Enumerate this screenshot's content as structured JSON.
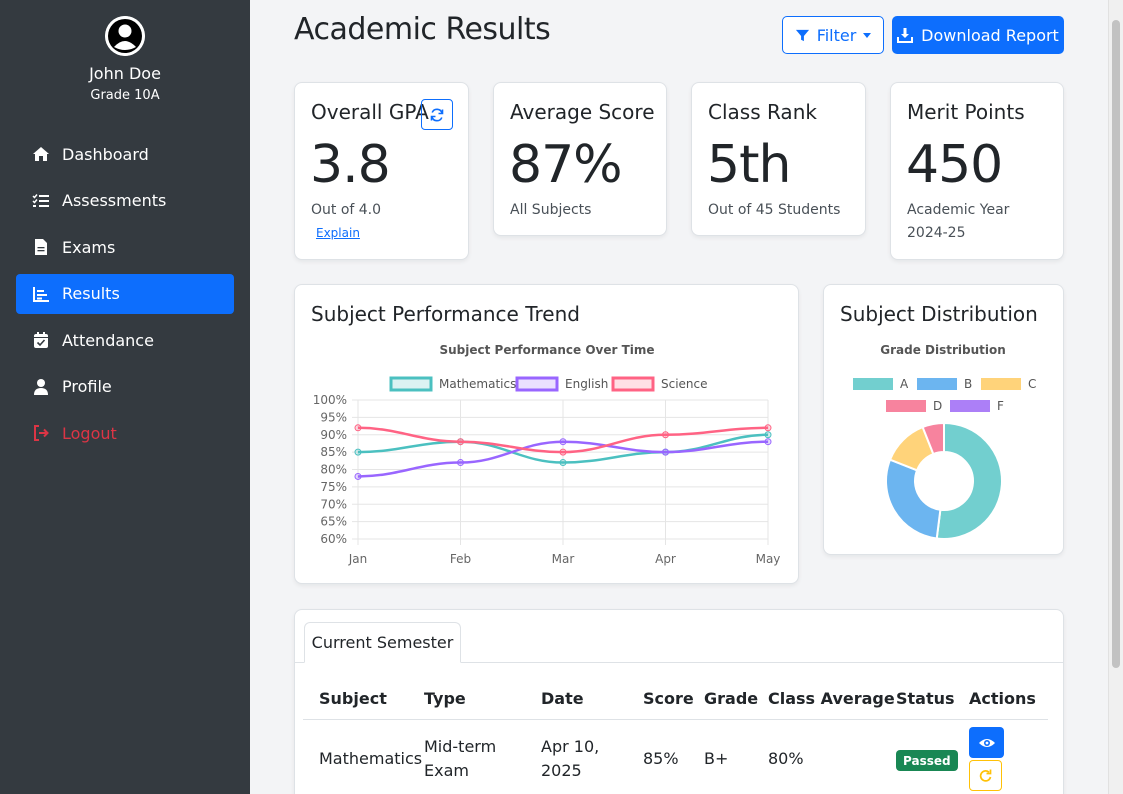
{
  "user": {
    "name": "John Doe",
    "grade": "Grade 10A"
  },
  "nav": [
    {
      "label": "Dashboard",
      "icon": "home-icon"
    },
    {
      "label": "Assessments",
      "icon": "checklist-icon"
    },
    {
      "label": "Exams",
      "icon": "document-icon"
    },
    {
      "label": "Results",
      "icon": "chart-icon",
      "active": true
    },
    {
      "label": "Attendance",
      "icon": "calendar-check-icon"
    },
    {
      "label": "Profile",
      "icon": "user-icon"
    },
    {
      "label": "Logout",
      "icon": "logout-icon"
    }
  ],
  "header": {
    "title": "Academic Results",
    "filter_label": "Filter",
    "download_label": "Download Report"
  },
  "stats": [
    {
      "title": "Overall GPA",
      "value": "3.8",
      "sub": "Out of 4.0",
      "link": "Explain"
    },
    {
      "title": "Average Score",
      "value": "87%",
      "sub": "All Subjects"
    },
    {
      "title": "Class Rank",
      "value": "5th",
      "sub": "Out of 45 Students"
    },
    {
      "title": "Merit Points",
      "value": "450",
      "sub": "Academic Year 2024-25"
    }
  ],
  "trend_card": {
    "title": "Subject Performance Trend"
  },
  "dist_card": {
    "title": "Subject Distribution"
  },
  "chart_data": [
    {
      "type": "line",
      "title": "Subject Performance Over Time",
      "x": [
        "Jan",
        "Feb",
        "Mar",
        "Apr",
        "May"
      ],
      "yticks": [
        "100%",
        "95%",
        "90%",
        "85%",
        "80%",
        "75%",
        "70%",
        "65%",
        "60%"
      ],
      "ylim": [
        60,
        100
      ],
      "grid": true,
      "legend": "top",
      "series": [
        {
          "name": "Mathematics",
          "color": "#4bc0c0",
          "values": [
            85,
            88,
            82,
            85,
            90
          ]
        },
        {
          "name": "English",
          "color": "#9966ff",
          "values": [
            78,
            82,
            88,
            85,
            88
          ]
        },
        {
          "name": "Science",
          "color": "#ff6384",
          "values": [
            92,
            88,
            85,
            90,
            92
          ]
        }
      ]
    },
    {
      "type": "pie",
      "title": "Grade Distribution",
      "legend": "top",
      "categories": [
        "A",
        "B",
        "C",
        "D",
        "F"
      ],
      "values": [
        52,
        29,
        13,
        6,
        0
      ],
      "colors": [
        "#72cfcf",
        "#6cb5f0",
        "#ffd37a",
        "#f7839e",
        "#ac7ff7"
      ]
    }
  ],
  "results": {
    "tab_label": "Current Semester",
    "columns": [
      "Subject",
      "Type",
      "Date",
      "Score",
      "Grade",
      "Class Average",
      "Status",
      "Actions"
    ],
    "rows": [
      {
        "subject": "Mathematics",
        "type": "Mid-term Exam",
        "date": "Apr 10, 2025",
        "score": "85%",
        "grade": "B+",
        "class_average": "80%",
        "status": "Passed"
      }
    ]
  }
}
